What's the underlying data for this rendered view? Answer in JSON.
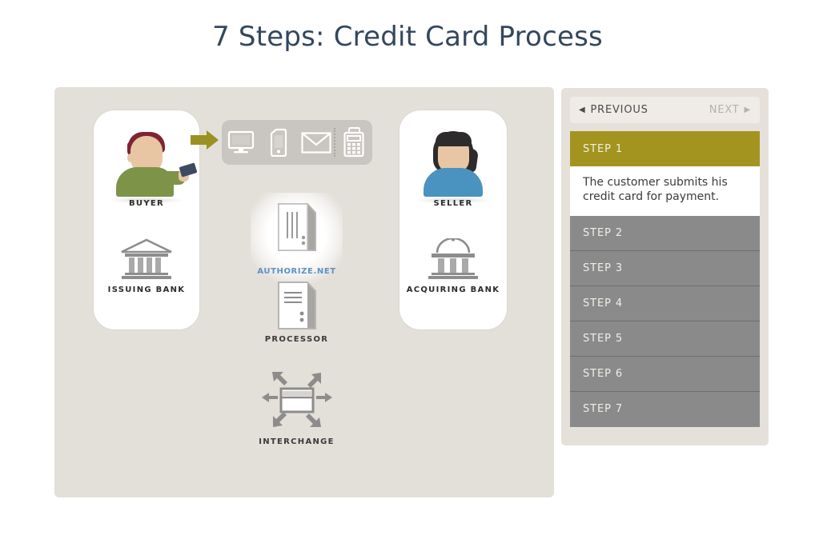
{
  "page": {
    "title": "7 Steps: Credit Card Process"
  },
  "diagram": {
    "buyer": {
      "label": "BUYER",
      "shirt_color": "#7d9448",
      "hair_color": "#7e2433",
      "card_color": "#3c4a63"
    },
    "issuing_bank": {
      "label": "ISSUING BANK"
    },
    "seller": {
      "label": "SELLER",
      "shirt_color": "#4a93c0",
      "hair_color": "#2e2b2c"
    },
    "acquiring_bank": {
      "label": "ACQUIRING BANK"
    },
    "devices": [
      {
        "name": "monitor-icon"
      },
      {
        "name": "mobile-phone-icon"
      },
      {
        "name": "envelope-icon"
      },
      {
        "name": "card-terminal-icon"
      }
    ],
    "gateway": {
      "label": "AUTHORIZE.NET",
      "label_color": "#5b93c7"
    },
    "processor": {
      "label": "PROCESSOR"
    },
    "interchange": {
      "label": "INTERCHANGE"
    },
    "arrow_color": "#9a9220",
    "stage_color": "#e3dfd9"
  },
  "sidebar": {
    "nav": {
      "previous_label": "PREVIOUS",
      "next_label": "NEXT",
      "prev_arrow": "◀",
      "next_arrow": "▶"
    },
    "active_color": "#a39420",
    "inactive_color": "#8a8a8a",
    "steps": [
      {
        "label": "STEP 1",
        "active": true,
        "body": "The customer submits his credit card for payment."
      },
      {
        "label": "STEP 2",
        "active": false,
        "body": ""
      },
      {
        "label": "STEP 3",
        "active": false,
        "body": ""
      },
      {
        "label": "STEP 4",
        "active": false,
        "body": ""
      },
      {
        "label": "STEP 5",
        "active": false,
        "body": ""
      },
      {
        "label": "STEP 6",
        "active": false,
        "body": ""
      },
      {
        "label": "STEP 7",
        "active": false,
        "body": ""
      }
    ]
  }
}
